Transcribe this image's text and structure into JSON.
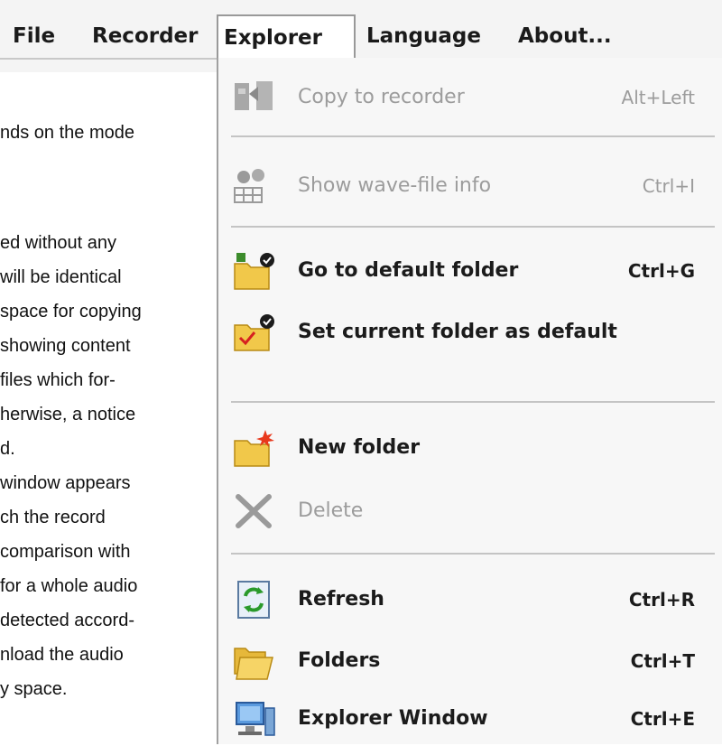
{
  "menubar": {
    "items": [
      {
        "label": "File"
      },
      {
        "label": "Recorder"
      },
      {
        "label": "Explorer"
      },
      {
        "label": "Language"
      },
      {
        "label": "About..."
      }
    ]
  },
  "background_text": [
    "nds on the mode",
    "ed without any",
    " will be identical",
    "space for copying",
    "showing content",
    "files which for-",
    "herwise, a notice",
    "d.",
    "window appears",
    "ch the record",
    "comparison with",
    "for a whole audio",
    "detected accord-",
    "nload the audio",
    "y space."
  ],
  "explorer_menu": {
    "items": [
      {
        "label": "Copy to recorder",
        "shortcut": "Alt+Left",
        "enabled": false,
        "icon": "copy-to-recorder-icon"
      },
      {
        "label": "Show wave-file info",
        "shortcut": "Ctrl+I",
        "enabled": false,
        "icon": "wave-info-icon"
      },
      {
        "label": "Go to default folder",
        "shortcut": "Ctrl+G",
        "enabled": true,
        "icon": "default-folder-icon"
      },
      {
        "label": "Set current folder as default",
        "shortcut": "",
        "enabled": true,
        "icon": "set-default-folder-icon"
      },
      {
        "label": "New folder",
        "shortcut": "",
        "enabled": true,
        "icon": "new-folder-icon"
      },
      {
        "label": "Delete",
        "shortcut": "",
        "enabled": false,
        "icon": "delete-icon"
      },
      {
        "label": "Refresh",
        "shortcut": "Ctrl+R",
        "enabled": true,
        "icon": "refresh-icon"
      },
      {
        "label": "Folders",
        "shortcut": "Ctrl+T",
        "enabled": true,
        "icon": "folders-icon"
      },
      {
        "label": "Explorer Window",
        "shortcut": "Ctrl+E",
        "enabled": true,
        "icon": "explorer-window-icon"
      }
    ]
  }
}
